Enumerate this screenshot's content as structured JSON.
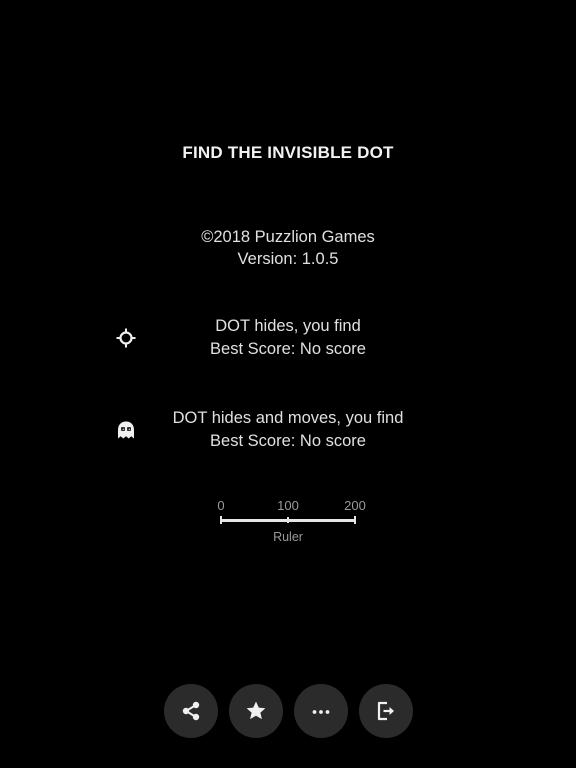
{
  "title": "FIND THE INVISIBLE DOT",
  "about": {
    "copyright": "©2018 Puzzlion Games",
    "version": "Version: 1.0.5"
  },
  "modes": [
    {
      "icon": "crosshair-icon",
      "description": "DOT hides, you find",
      "best_score": "Best Score: No score"
    },
    {
      "icon": "ghost-icon",
      "description": "DOT hides and moves, you find",
      "best_score": "Best Score: No score"
    }
  ],
  "ruler": {
    "ticks": [
      "0",
      "100",
      "200"
    ],
    "caption": "Ruler"
  },
  "toolbar": {
    "buttons": [
      {
        "icon": "share-icon"
      },
      {
        "icon": "star-icon"
      },
      {
        "icon": "more-icon"
      },
      {
        "icon": "exit-icon"
      }
    ]
  },
  "colors": {
    "background": "#000000",
    "text": "#e0e0e0",
    "muted_text": "#9a9a9a",
    "button_bg": "#2b2b2b"
  }
}
